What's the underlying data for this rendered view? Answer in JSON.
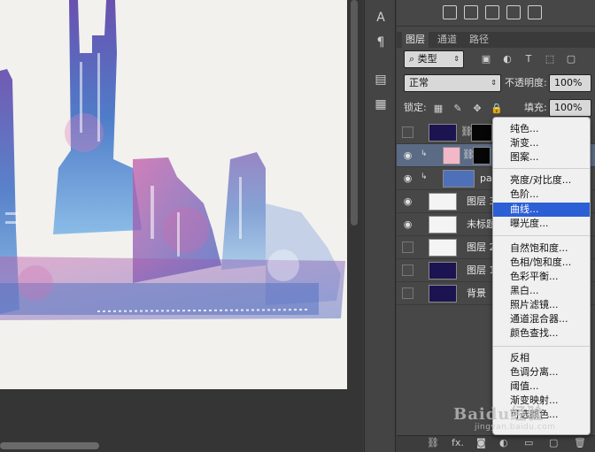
{
  "panel": {
    "tabs": [
      "图层",
      "通道",
      "路径"
    ],
    "filter_kind": "类型",
    "blend_mode": "正常",
    "opacity_label": "不透明度:",
    "opacity_value": "100%",
    "lock_label": "锁定:",
    "fill_label": "填充:",
    "fill_value": "100%"
  },
  "layers": [
    {
      "name": "",
      "visible": false
    },
    {
      "name": "",
      "visible": true,
      "selected": true
    },
    {
      "name": "pa",
      "visible": true
    },
    {
      "name": "图层 3",
      "visible": true
    },
    {
      "name": "未标题",
      "visible": true
    },
    {
      "name": "图层 2",
      "visible": false
    },
    {
      "name": "图层 1",
      "visible": false
    },
    {
      "name": "背景",
      "visible": false
    }
  ],
  "menu": {
    "items": [
      "纯色...",
      "渐变...",
      "图案...",
      "亮度/对比度...",
      "色阶...",
      "曲线...",
      "曝光度...",
      "自然饱和度...",
      "色相/饱和度...",
      "色彩平衡...",
      "黑白...",
      "照片滤镜...",
      "通道混合器...",
      "颜色查找...",
      "反相",
      "色调分离...",
      "阈值...",
      "渐变映射...",
      "可选颜色..."
    ],
    "highlighted": "曲线..."
  },
  "tools": [
    "character-icon",
    "paragraph-icon",
    "history-icon",
    "notes-icon"
  ],
  "bottom_bar": {
    "fx_label": "fx."
  },
  "watermark": {
    "logo": "Baidu经验",
    "url": "jingyan.baidu.com"
  },
  "colors": {
    "menu_highlight": "#2c5fd6",
    "selected_layer": "#5b6b85",
    "panel_bg": "#474747",
    "canvas_paper": "#f2f1ee"
  }
}
